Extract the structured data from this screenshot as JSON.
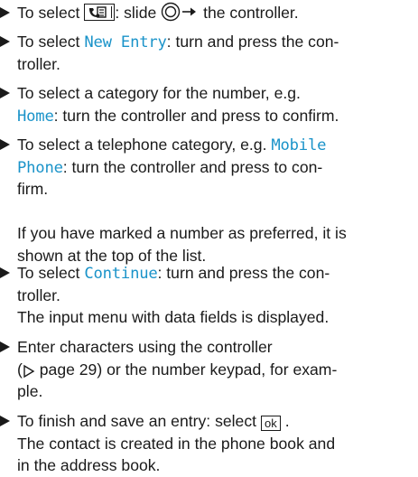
{
  "steps": [
    {
      "lines": [
        [
          "To select ",
          {
            "icon": "phonebook-key-icon"
          },
          ": slide ",
          {
            "icon": "controller-slide-icon"
          },
          " the controller."
        ]
      ]
    },
    {
      "lines": [
        [
          "To select ",
          {
            "hl": "New Entry"
          },
          ": turn and press the con-"
        ],
        [
          "troller."
        ]
      ]
    },
    {
      "lines": [
        [
          "To select a category for the number, e.g."
        ],
        [
          {
            "hl": "Home"
          },
          ": turn the controller and press to confirm."
        ]
      ]
    },
    {
      "lines": [
        [
          "To select a telephone category, e.g. ",
          {
            "hl": "Mobile"
          }
        ],
        [
          {
            "hl": "Phone"
          },
          ": turn the controller and press to con-"
        ],
        [
          "firm."
        ],
        [
          ""
        ],
        [
          "If you have marked a number as preferred, it is"
        ],
        [
          "shown at the top of the list."
        ]
      ]
    },
    {
      "lines": [
        [
          "To select ",
          {
            "hl": "Continue"
          },
          ": turn and press the con-"
        ],
        [
          "troller."
        ],
        [
          "The input menu with data fields is displayed."
        ]
      ]
    },
    {
      "lines": [
        [
          "Enter characters using the controller"
        ],
        [
          "(",
          {
            "icon": "page-ref-icon"
          },
          " page 29) or the number keypad, for exam-"
        ],
        [
          "ple."
        ]
      ]
    },
    {
      "lines": [
        [
          "To finish and save an entry: select ",
          {
            "okbox": "ok"
          },
          " ."
        ],
        [
          "The contact is created in the phone book and"
        ],
        [
          "in the address book."
        ]
      ]
    }
  ],
  "colors": {
    "highlight": "#1a93c9",
    "text": "#1a1a1a"
  }
}
